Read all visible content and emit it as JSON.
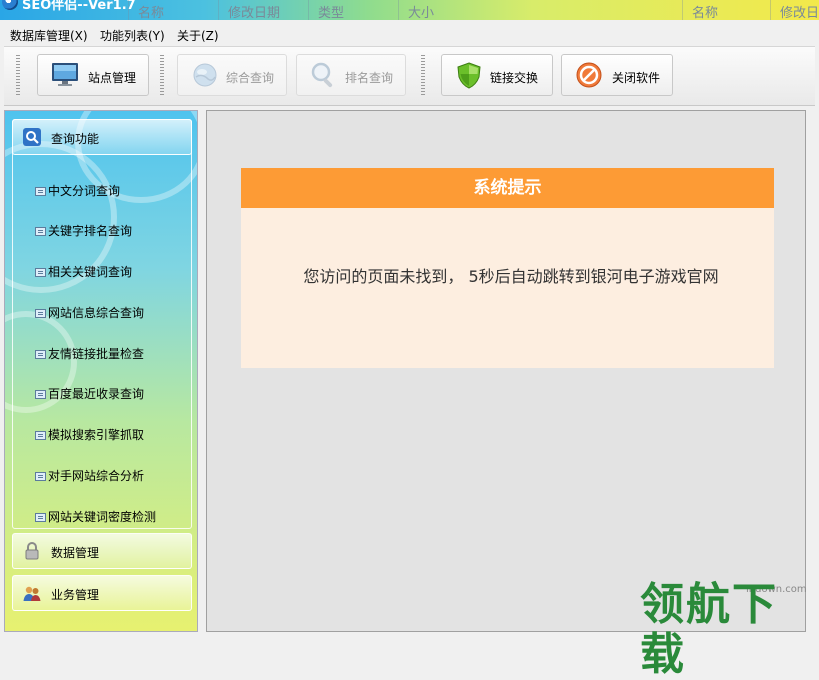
{
  "titlebar": {
    "app_title": "SEO伴侣--Ver1.7",
    "columns": [
      "名称",
      "修改日期",
      "类型",
      "大小",
      "名称",
      "修改日"
    ]
  },
  "menu": [
    "数据库管理(X)",
    "功能列表(Y)",
    "关于(Z)"
  ],
  "toolbar": {
    "site_manage": "站点管理",
    "combined_query": "综合查询",
    "rank_query": "排名查询",
    "link_exchange": "链接交换",
    "close_software": "关闭软件"
  },
  "sidebar": {
    "query_header": "查询功能",
    "items": [
      "中文分词查询",
      "关键字排名查询",
      "相关关键词查询",
      "网站信息综合查询",
      "友情链接批量检查",
      "百度最近收录查询",
      "模拟搜索引擎抓取",
      "对手网站综合分析",
      "网站关键词密度检测"
    ],
    "data_manage": "数据管理",
    "business_manage": "业务管理"
  },
  "notice": {
    "title": "系统提示",
    "message": "您访问的页面未找到， 5秒后自动跳转到银河电子游戏官网"
  },
  "watermark": {
    "site": "lhdown.com",
    "brand": "领航下载"
  }
}
